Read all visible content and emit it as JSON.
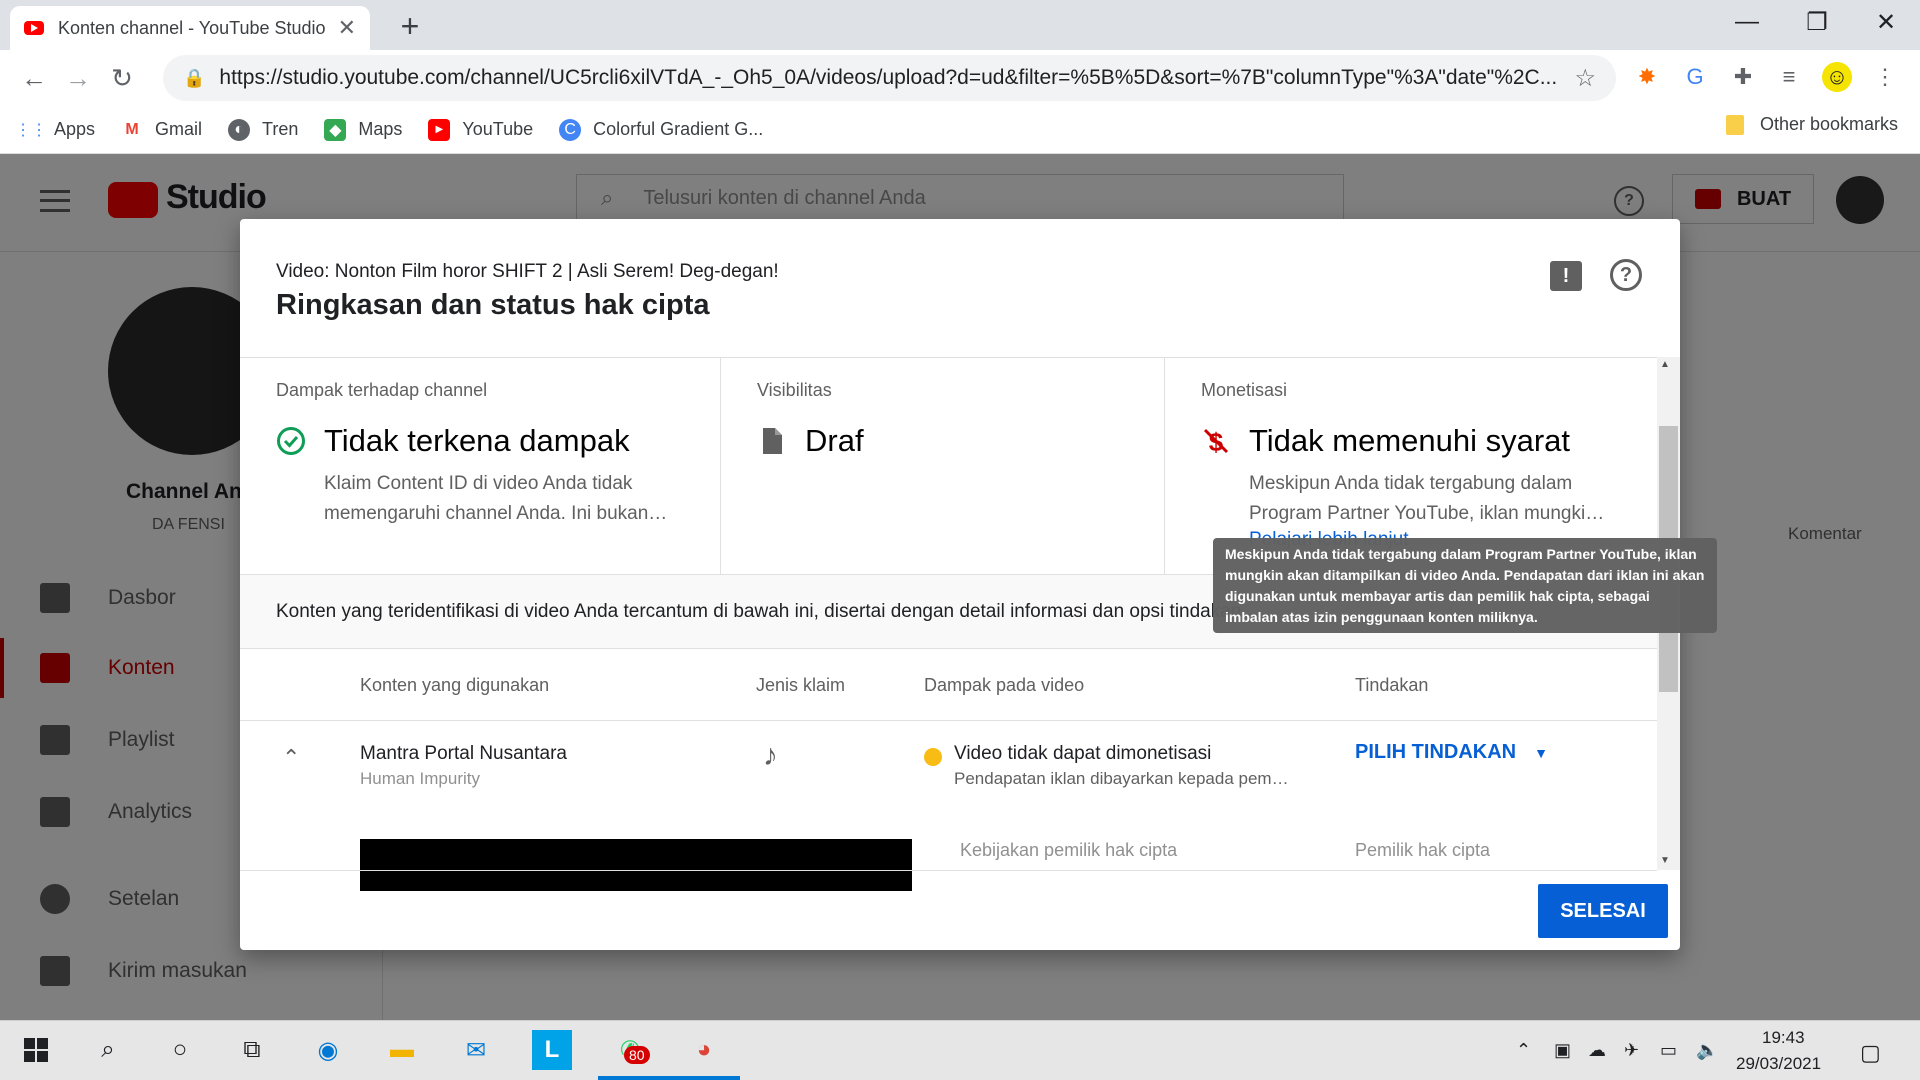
{
  "browser": {
    "tab_title": "Konten channel - YouTube Studio",
    "tab_close": "✕",
    "new_tab": "+",
    "window_controls": [
      "—",
      "❐",
      "✕"
    ],
    "url": "https://studio.youtube.com/channel/UC5rcli6xilVTdA_-_Oh5_0A/videos/upload?d=ud&filter=%5B%5D&sort=%7B\"columnType\"%3A\"date\"%2C...",
    "bookmarks": [
      {
        "label": "Apps",
        "icon": "apps-grid-icon",
        "color": "#4285f4"
      },
      {
        "label": "Gmail",
        "icon": "gmail-icon",
        "color": "#ea4335"
      },
      {
        "label": "Tren",
        "icon": "globe-icon",
        "color": "#5f6368"
      },
      {
        "label": "Maps",
        "icon": "maps-icon",
        "color": "#34a853"
      },
      {
        "label": "YouTube",
        "icon": "youtube-icon",
        "color": "#ff0000"
      },
      {
        "label": "Colorful Gradient G...",
        "icon": "colorful-c-icon",
        "color": "#4285f4"
      }
    ],
    "other_bookmarks": "Other bookmarks"
  },
  "studio": {
    "logo_text": "Studio",
    "search_placeholder": "Telusuri konten di channel Anda",
    "create_label": "BUAT",
    "channel_name": "Channel Anda",
    "channel_sub": "DA FENSI",
    "sidebar": [
      {
        "label": "Dasbor",
        "icon": "dashboard-icon"
      },
      {
        "label": "Konten",
        "icon": "content-icon",
        "active": true
      },
      {
        "label": "Playlist",
        "icon": "playlist-icon"
      },
      {
        "label": "Analytics",
        "icon": "analytics-icon"
      },
      {
        "label": "Setelan",
        "icon": "settings-icon"
      },
      {
        "label": "Kirim masukan",
        "icon": "feedback-icon"
      }
    ],
    "bg_columns": [
      "Komentar"
    ],
    "accent": "#cc0000"
  },
  "dialog": {
    "video_label": "Video: Nonton Film horor SHIFT 2 | Asli Serem! Deg-degan!",
    "title": "Ringkasan dan status hak cipta",
    "cards": [
      {
        "label": "Dampak terhadap channel",
        "value": "Tidak terkena dampak",
        "icon": "check-circle-icon",
        "desc": "Klaim Content ID di video Anda tidak memengaruhi channel Anda. Ini bukan…"
      },
      {
        "label": "Visibilitas",
        "value": "Draf",
        "icon": "document-icon",
        "desc": ""
      },
      {
        "label": "Monetisasi",
        "value": "Tidak memenuhi syarat",
        "icon": "no-money-icon",
        "desc": "Meskipun Anda tidak tergabung dalam Program Partner YouTube, iklan mungki…",
        "link": "Pelajari lebih lanjut"
      }
    ],
    "info_text": "Konten yang teridentifikasi di video Anda tercantum di bawah ini, disertai dengan detail informasi dan opsi tindakan",
    "table": {
      "headers": [
        "Konten yang digunakan",
        "Jenis klaim",
        "Dampak pada video",
        "Tindakan"
      ],
      "row": {
        "title": "Mantra Portal Nusantara",
        "artist": "Human Impurity",
        "claim_icon": "music-note-icon",
        "impact": "Video tidak dapat dimonetisasi",
        "impact_sub": "Pendapatan iklan dibayarkan kepada pem…",
        "impact_color": "#f9bc15",
        "action": "PILIH TINDAKAN",
        "sub_col1": "Kebijakan pemilik hak cipta",
        "sub_col2": "Pemilik hak cipta"
      }
    },
    "done_label": "SELESAI",
    "tooltip": "Meskipun Anda tidak tergabung dalam Program Partner YouTube, iklan mungkin akan ditampilkan di video Anda. Pendapatan dari iklan ini akan digunakan untuk membayar artis dan pemilik hak cipta, sebagai imbalan atas izin penggunaan konten miliknya.",
    "primary_color": "#065fd4"
  },
  "taskbar": {
    "time": "19:43",
    "date": "29/03/2021",
    "whatsapp_badge": "80"
  }
}
